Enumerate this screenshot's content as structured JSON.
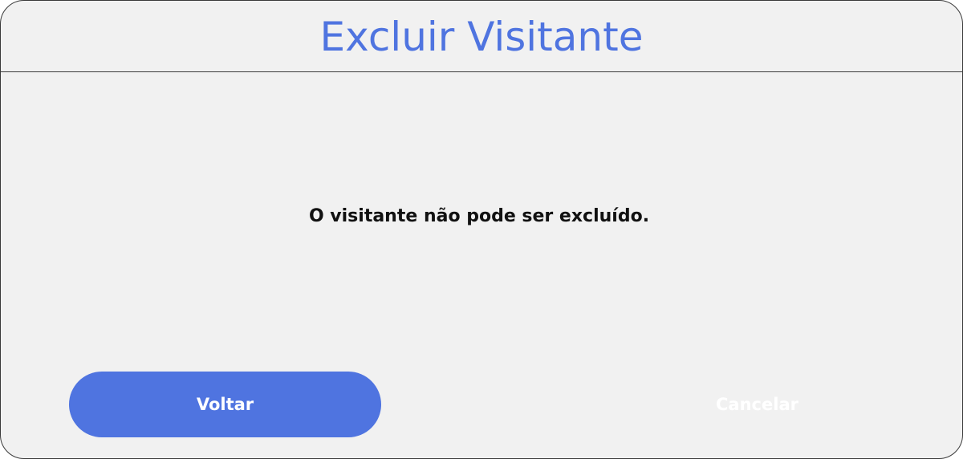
{
  "dialog": {
    "title": "Excluir Visitante",
    "message": "O visitante não pode ser excluído.",
    "buttons": {
      "back_label": "Voltar",
      "cancel_label": "Cancelar"
    }
  },
  "colors": {
    "accent": "#4f74e0",
    "background": "#f1f1f1",
    "border": "#3a3a3a",
    "text": "#111111"
  }
}
